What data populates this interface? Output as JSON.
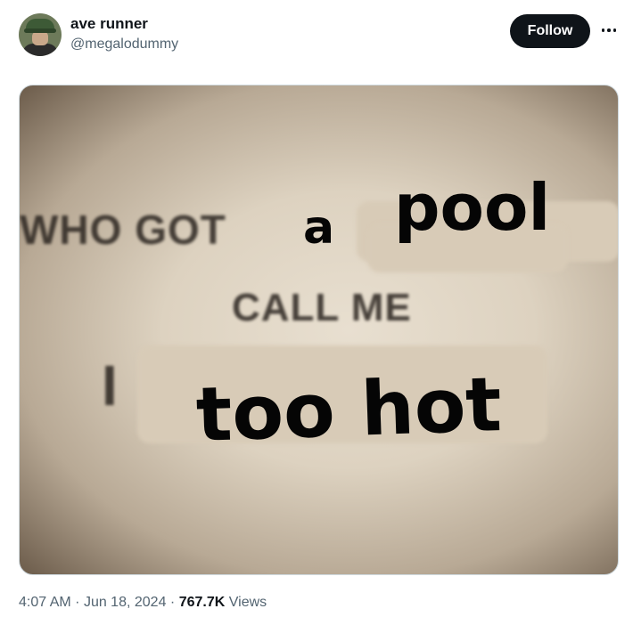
{
  "author": {
    "name": "ave runner",
    "handle": "@megalodummy"
  },
  "actions": {
    "follow_label": "Follow",
    "more_icon": "more-horizontal-icon"
  },
  "media": {
    "line1_printed": "WHO GOT",
    "line1_word": "a",
    "line1_inserted": "pool",
    "line2_printed": "CALL ME",
    "line3_printed": "I",
    "line3_inserted": "too hot"
  },
  "meta": {
    "time": "4:07 AM",
    "date": "Jun 18, 2024",
    "views_count": "767.7K",
    "views_label": "Views",
    "separator": "·"
  },
  "colors": {
    "primary_text": "#0f1419",
    "secondary_text": "#536471",
    "button_bg": "#0f1419",
    "border": "#cfd9de"
  }
}
